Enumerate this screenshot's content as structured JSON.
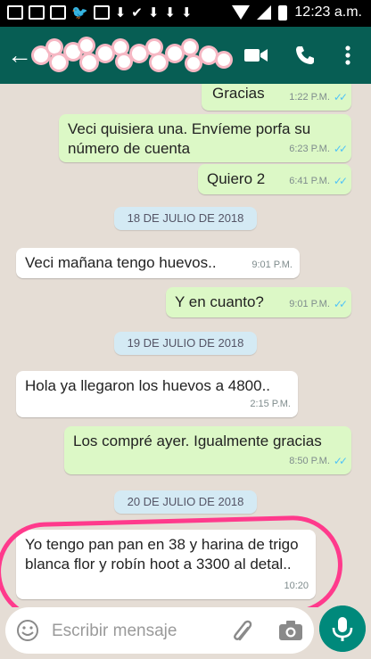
{
  "status_bar": {
    "time": "12:23 a.m."
  },
  "header": {
    "back_icon": "arrow-left-icon",
    "contact_name_redacted": true
  },
  "messages": [
    {
      "id": "m1",
      "dir": "out",
      "text": "Gracias",
      "time": "1:22 P.M.",
      "read": true
    },
    {
      "id": "m2",
      "dir": "out",
      "text": "Veci quisiera una. Envíeme porfa su número de cuenta",
      "time": "6:23 P.M.",
      "read": true
    },
    {
      "id": "m3",
      "dir": "out",
      "text": "Quiero 2",
      "time": "6:41 P.M.",
      "read": true
    },
    {
      "id": "d1",
      "dir": "date",
      "text": "18 DE JULIO DE 2018"
    },
    {
      "id": "m4",
      "dir": "in",
      "text": "Veci mañana tengo huevos..",
      "time": "9:01 P.M."
    },
    {
      "id": "m5",
      "dir": "out",
      "text": "Y en cuanto?",
      "time": "9:01 P.M.",
      "read": true
    },
    {
      "id": "d2",
      "dir": "date",
      "text": "19 DE JULIO DE 2018"
    },
    {
      "id": "m6",
      "dir": "in",
      "text": "Hola ya llegaron los huevos a 4800..",
      "time": "2:15 P.M."
    },
    {
      "id": "m7",
      "dir": "out",
      "text": "Los compré ayer. Igualmente gracias",
      "time": "8:50 P.M.",
      "read": true
    },
    {
      "id": "d3",
      "dir": "date",
      "text": "20 DE JULIO DE 2018"
    },
    {
      "id": "m8",
      "dir": "in",
      "text": "Yo tengo pan pan en 38 y harina de trigo blanca flor y robín hoot a 3300 al detal..",
      "time": "10:20"
    }
  ],
  "composer": {
    "placeholder": "Escribir mensaje"
  },
  "colors": {
    "header": "#075e54",
    "outgoing": "#dcf8c6",
    "incoming": "#ffffff",
    "highlight": "#ff3a8c",
    "mic": "#00897b"
  }
}
